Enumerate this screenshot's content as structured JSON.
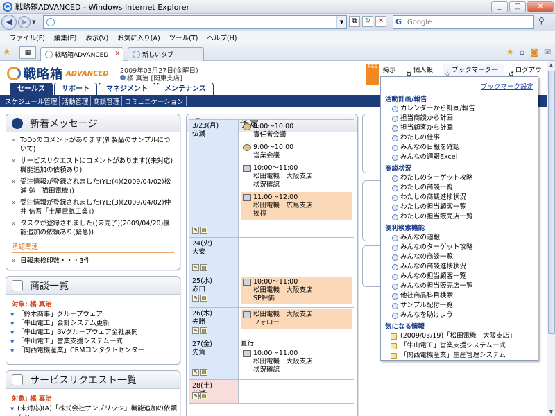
{
  "browser": {
    "title": "戦略箱ADVANCED - Windows Internet Explorer",
    "search_placeholder": "Google",
    "menu": [
      "ファイル(F)",
      "編集(E)",
      "表示(V)",
      "お気に入り(A)",
      "ツール(T)",
      "ヘルプ(H)"
    ],
    "tabs": [
      {
        "label": "戦略箱ADVANCED",
        "active": true
      },
      {
        "label": "新しいタブ",
        "active": false
      }
    ]
  },
  "app": {
    "logo_jp": "戦略箱",
    "logo_en": "ADVANCED",
    "date": "2009年03月27日(金曜日)",
    "user": "橘 真治 [関東支店]",
    "header_links": {
      "rss": "RSS",
      "board": "掲示板",
      "settings": "個人設定",
      "bookmark": "ブックマーク一覧",
      "logout": "ログアウト"
    },
    "nav_tabs": [
      "セールス",
      "サポート",
      "マネジメント",
      "メンテナンス"
    ],
    "subnav": [
      "スケジュール管理",
      "活動管理",
      "商談管理",
      "コミュニケーション"
    ]
  },
  "messages": {
    "title": "新着メッセージ",
    "items": [
      "ToDoのコメントがあります(新製品のサンプルについて)",
      "サービスリクエストにコメントがあります((未対応)機能追加の依頼あり)",
      "受注情報が登録されました(YL:(4)(2009/04/02)松浦 勉「猫田電機」)",
      "受注情報が登録されました(YL:(3)(2009/04/02)仲井 信吾「土屋電気工業」)",
      "タスクが登録されました((未完了)(2009/04/20)機能追加の依頼あり(緊急))"
    ],
    "approval_label": "承認関連",
    "approval_items": [
      "日報未検印数・・・3件"
    ]
  },
  "deals": {
    "title": "商談一覧",
    "target": "対象: 橘 真治",
    "items": [
      "「鈴木商事」グループウェア",
      "「牛山電工」会計システム更新",
      "「牛山電工」BVグループウェア全社展開",
      "「牛山電工」営業支援システム一式",
      "「関西電機産業」CRMコンタクトセンター"
    ]
  },
  "service": {
    "title": "サービスリクエスト一覧",
    "target": "対象: 橘 真治",
    "items": [
      "(未対応)(A)「株式会社サンブリッジ」機能追加の依頼あり"
    ]
  },
  "week": {
    "title": "今週の予定",
    "days": [
      {
        "date": "3/23(月)",
        "rokuyo": "仏滅",
        "type": "weekday",
        "events": [
          {
            "time": "9:00〜10:00",
            "lines": [
              "責任者会議"
            ],
            "icon": "people",
            "highlight": false
          },
          {
            "time": "9:00〜10:00",
            "lines": [
              "営業会議"
            ],
            "icon": "people",
            "highlight": false
          },
          {
            "time": "10:00〜11:00",
            "lines": [
              "松田電機　大阪支店",
              "状況確認"
            ],
            "icon": "visit",
            "highlight": false
          },
          {
            "time": "11:00〜12:00",
            "lines": [
              "松田電機　広島支店",
              "挨拶"
            ],
            "icon": "visit",
            "highlight": true
          }
        ]
      },
      {
        "date": "24(火)",
        "rokuyo": "大安",
        "type": "weekday",
        "events": []
      },
      {
        "date": "25(水)",
        "rokuyo": "赤口",
        "type": "weekday",
        "events": [
          {
            "time": "10:00〜11:00",
            "lines": [
              "松田電機　大阪支店",
              "SP評価"
            ],
            "icon": "visit",
            "highlight": true
          }
        ]
      },
      {
        "date": "26(木)",
        "rokuyo": "先勝",
        "type": "weekday",
        "events": [
          {
            "time": "",
            "lines": [
              "松田電機　大阪支店",
              "フォロー"
            ],
            "icon": "visit",
            "highlight": true
          }
        ]
      },
      {
        "date": "27(金)",
        "rokuyo": "先負",
        "type": "weekday",
        "prefix": "直行",
        "events": [
          {
            "time": "10:00〜11:00",
            "lines": [
              "松田電機　大阪支店",
              "状況確認"
            ],
            "icon": "visit",
            "highlight": false
          }
        ]
      },
      {
        "date": "28(土)",
        "rokuyo": "仏滅",
        "type": "saturday",
        "events": []
      }
    ]
  },
  "bookmarks": {
    "settings_link": "ブックマーク設定",
    "sections": [
      {
        "title": "活動計画/報告",
        "items": [
          "カレンダーから計画/報告",
          "担当商談から計画",
          "担当顧客から計画",
          "わたしの仕事",
          "みんなの日報を確認",
          "みんなの週報Excel"
        ]
      },
      {
        "title": "商談状況",
        "items": [
          "わたしのターゲット攻略",
          "わたしの商談一覧",
          "わたしの商談進捗状況",
          "わたしの担当顧客一覧",
          "わたしの担当販売店一覧"
        ]
      },
      {
        "title": "便利検索機能",
        "items": [
          "みんなの週報",
          "みんなのターゲット攻略",
          "みんなの商談一覧",
          "みんなの商談進捗状況",
          "みんなの担当顧客一覧",
          "みんなの担当販売店一覧",
          "他社商品科目検索",
          "サンプル配付一覧",
          "みんなを助けよう"
        ]
      },
      {
        "title": "気になる情報",
        "items": [
          "(2009/03/19)「松田電機　大阪支店」",
          "「牛山電工」営業支援システム一式",
          "「関西電機産業」生産管理システム"
        ],
        "note": true
      }
    ]
  }
}
